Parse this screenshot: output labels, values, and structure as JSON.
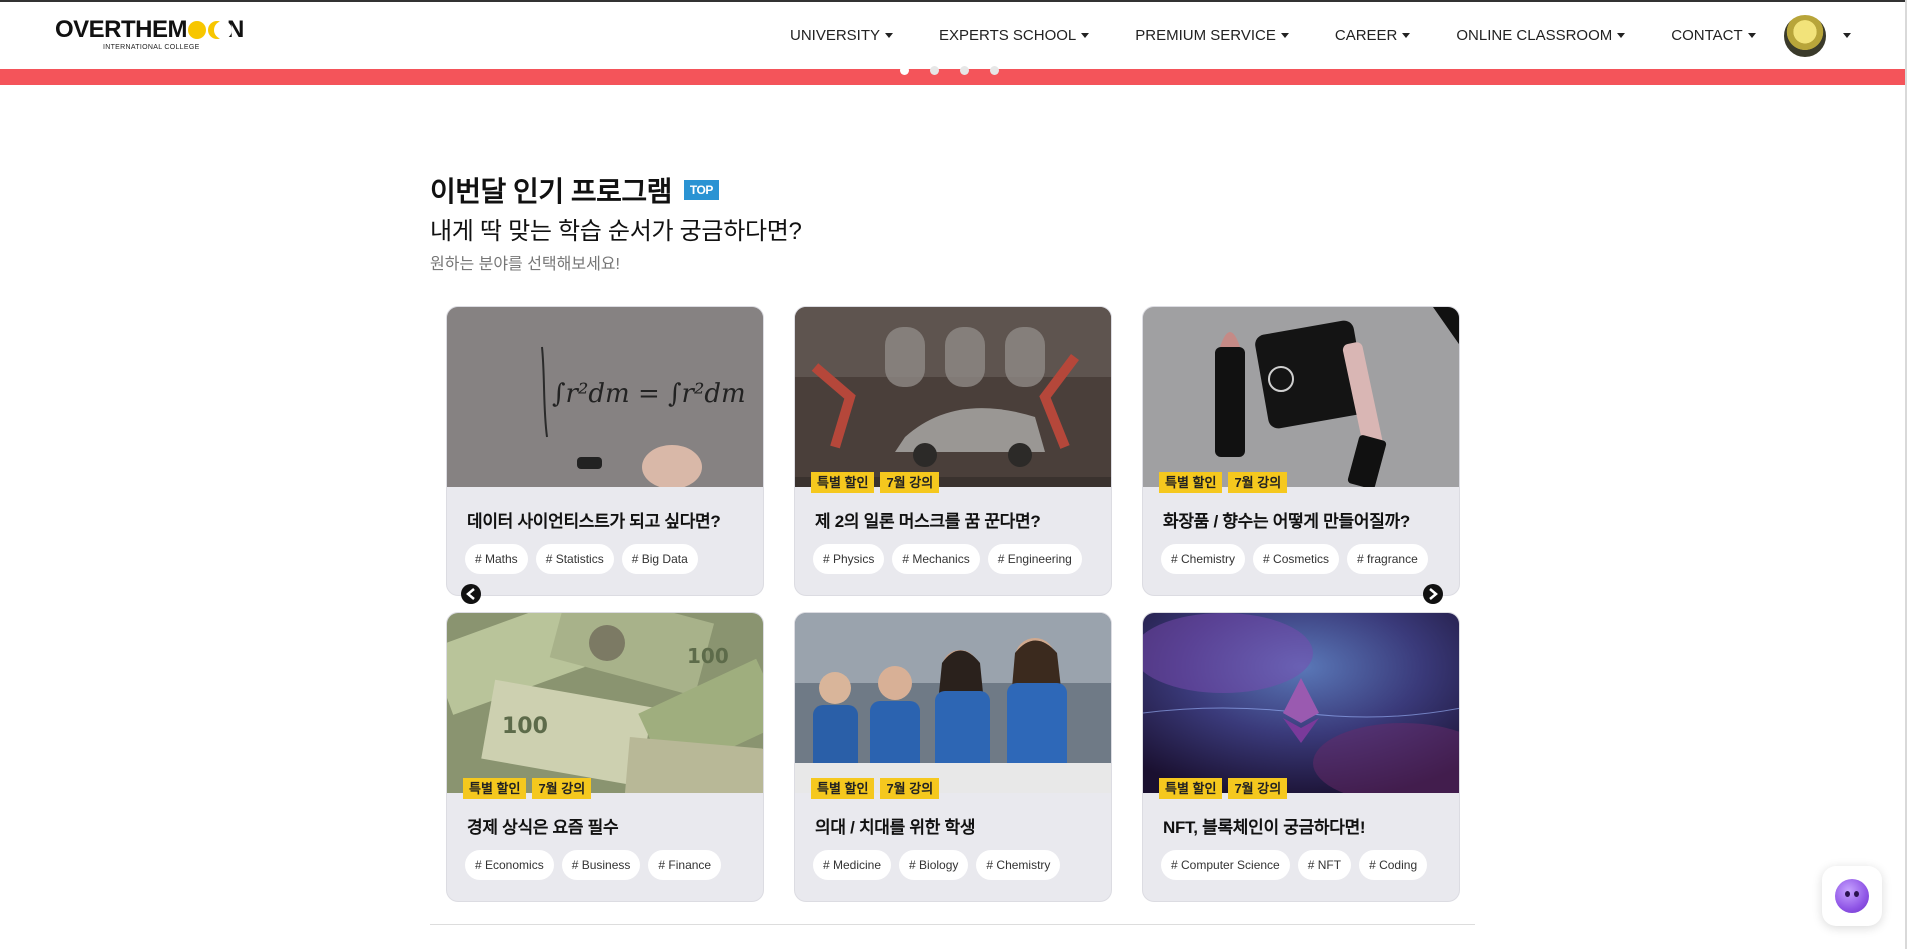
{
  "nav": {
    "logo_text_1": "OVERTHEM",
    "logo_text_2": "N",
    "logo_sub": "INTERNATIONAL COLLEGE",
    "items": [
      {
        "label": "UNIVERSITY"
      },
      {
        "label": "EXPERTS SCHOOL"
      },
      {
        "label": "PREMIUM SERVICE"
      },
      {
        "label": "CAREER"
      },
      {
        "label": "ONLINE CLASSROOM"
      },
      {
        "label": "CONTACT"
      }
    ]
  },
  "section": {
    "title": "이번달 인기 프로그램",
    "badge": "TOP",
    "subtitle": "내게 딱 맞는 학습 순서가 궁금하다면?",
    "description": "원하는 분야를 선택해보세요!"
  },
  "cards": [
    {
      "title": "데이터 사이언티스트가 되고 싶다면?",
      "badges": [],
      "tags": [
        "# Maths",
        "# Statistics",
        "# Big Data"
      ]
    },
    {
      "title": "제 2의 일론 머스크를 꿈 꾼다면?",
      "badges": [
        "특별 할인",
        "7월 강의"
      ],
      "tags": [
        "# Physics",
        "# Mechanics",
        "# Engineering"
      ]
    },
    {
      "title": "화장품 / 향수는 어떻게 만들어질까?",
      "badges": [
        "특별 할인",
        "7월 강의"
      ],
      "tags": [
        "# Chemistry",
        "# Cosmetics",
        "# fragrance"
      ]
    },
    {
      "title": "경제 상식은 요즘 필수",
      "badges": [
        "특별 할인",
        "7월 강의"
      ],
      "tags": [
        "# Economics",
        "# Business",
        "# Finance"
      ]
    },
    {
      "title": "의대 / 치대를 위한 학생",
      "badges": [
        "특별 할인",
        "7월 강의"
      ],
      "tags": [
        "# Medicine",
        "# Biology",
        "# Chemistry"
      ]
    },
    {
      "title": "NFT, 블록체인이 궁금하다면!",
      "badges": [
        "특별 할인",
        "7월 강의"
      ],
      "tags": [
        "# Computer Science",
        "# NFT",
        "# Coding"
      ]
    }
  ],
  "colors": {
    "accent_red": "#f4545a",
    "badge_yellow": "#f5c81e",
    "top_badge_blue": "#2a93d3"
  }
}
